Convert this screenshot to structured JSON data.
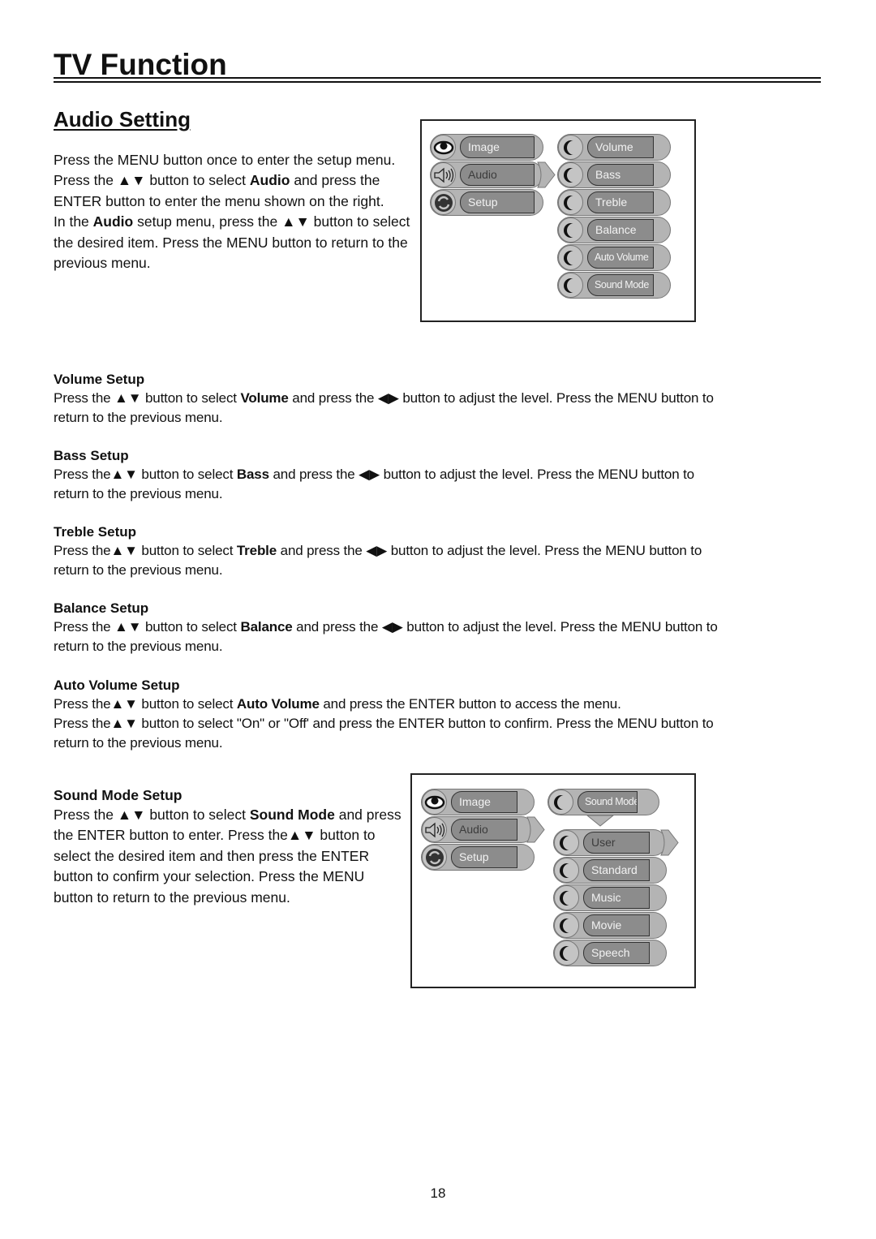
{
  "header": {
    "title": "TV Function",
    "section_title": "Audio Setting"
  },
  "intro": {
    "p1_a": "Press the MENU button once to enter the setup menu. Press the ",
    "p1_arrows": "▲▼",
    "p1_b": " button to select ",
    "p1_bold": "Audio",
    "p1_c": " and press the ENTER button to enter the menu shown on the right.",
    "p2_a": "In the ",
    "p2_bold": "Audio",
    "p2_b": " setup menu, press the ",
    "p2_arrows": "▲▼",
    "p2_c": " button to select the desired item. Press the MENU button to return to the previous menu."
  },
  "menu1": {
    "main_items": [
      {
        "label": "Image",
        "icon": "eye-icon"
      },
      {
        "label": "Audio",
        "icon": "speaker-icon",
        "selected": true
      },
      {
        "label": "Setup",
        "icon": "setup-icon"
      }
    ],
    "sub_items": [
      {
        "label": "Volume"
      },
      {
        "label": "Bass"
      },
      {
        "label": "Treble"
      },
      {
        "label": "Balance"
      },
      {
        "label": "Auto Volume"
      },
      {
        "label": "Sound Mode"
      }
    ]
  },
  "sections": [
    {
      "heading": "Volume Setup",
      "a": "Press the ",
      "arrows_ud": "▲▼",
      "b": " button to select ",
      "bold": "Volume",
      "c": " and press the ",
      "arrows_lr": "◀▶",
      "d": " button to adjust the level. Press the MENU button to return to the previous menu."
    },
    {
      "heading": "Bass Setup",
      "a": "Press the",
      "arrows_ud": "▲▼",
      "b": " button to select ",
      "bold": "Bass",
      "c": " and press the ",
      "arrows_lr": "◀▶",
      "d": " button to adjust the level. Press the MENU button to return to the previous menu."
    },
    {
      "heading": "Treble Setup",
      "a": "Press the",
      "arrows_ud": "▲▼",
      "b": " button to select ",
      "bold": "Treble",
      "c": " and press the ",
      "arrows_lr": "◀▶",
      "d": " button to adjust the level. Press the MENU button to return to the previous menu."
    },
    {
      "heading": "Balance Setup",
      "a": "Press the ",
      "arrows_ud": "▲▼",
      "b": " button to select ",
      "bold": "Balance",
      "c": " and press the ",
      "arrows_lr": "◀▶",
      "d": " button to adjust the level. Press the MENU button to return to the previous menu."
    }
  ],
  "auto_volume": {
    "heading": "Auto Volume Setup",
    "l1_a": "Press the",
    "l1_arrows": "▲▼",
    "l1_b": " button to select ",
    "l1_bold": "Auto Volume",
    "l1_c": " and press the ENTER button to access the menu.",
    "l2_a": "Press the",
    "l2_arrows": "▲▼",
    "l2_b": " button to select \"On\" or \"Off' and press the ENTER button to confirm. Press the MENU button to return to the previous menu."
  },
  "sound_mode": {
    "heading": "Sound Mode Setup",
    "a": "Press the ",
    "arrows1": "▲▼",
    "b": "  button to select ",
    "bold": "Sound Mode",
    "c": " and press the ENTER button to enter. Press the",
    "arrows2": "▲▼",
    "d": " button to select the desired item and then press the ENTER button to confirm your selection. Press the MENU button to return to the previous menu."
  },
  "menu2": {
    "main_items": [
      {
        "label": "Image",
        "icon": "eye-icon"
      },
      {
        "label": "Audio",
        "icon": "speaker-icon",
        "selected": true
      },
      {
        "label": "Setup",
        "icon": "setup-icon"
      }
    ],
    "parent_item": {
      "label": "Sound Mode"
    },
    "options": [
      {
        "label": "User",
        "selected": true
      },
      {
        "label": "Standard"
      },
      {
        "label": "Music"
      },
      {
        "label": "Movie"
      },
      {
        "label": "Speech"
      }
    ]
  },
  "footer": {
    "page_number": "18"
  }
}
